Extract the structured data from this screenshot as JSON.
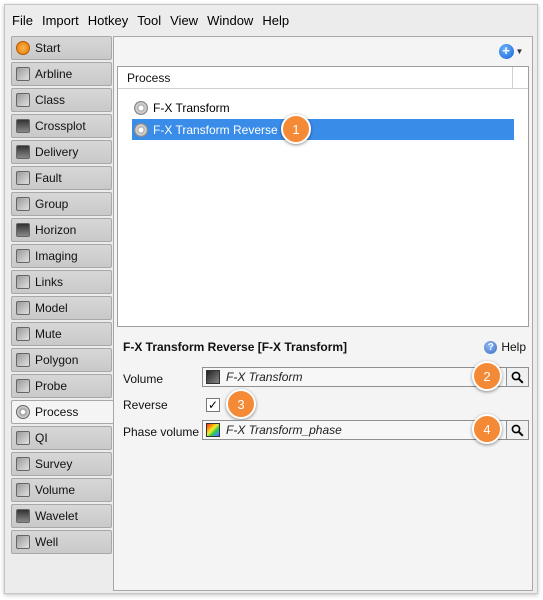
{
  "menu": [
    "File",
    "Import",
    "Hotkey",
    "Tool",
    "View",
    "Window",
    "Help"
  ],
  "sidebar": {
    "items": [
      {
        "label": "Start",
        "icon": "start-icon"
      },
      {
        "label": "Arbline",
        "icon": "arbline-icon"
      },
      {
        "label": "Class",
        "icon": "class-icon"
      },
      {
        "label": "Crossplot",
        "icon": "crossplot-icon"
      },
      {
        "label": "Delivery",
        "icon": "delivery-icon"
      },
      {
        "label": "Fault",
        "icon": "fault-icon"
      },
      {
        "label": "Group",
        "icon": "group-icon"
      },
      {
        "label": "Horizon",
        "icon": "horizon-icon"
      },
      {
        "label": "Imaging",
        "icon": "imaging-icon"
      },
      {
        "label": "Links",
        "icon": "links-icon"
      },
      {
        "label": "Model",
        "icon": "model-icon"
      },
      {
        "label": "Mute",
        "icon": "mute-icon"
      },
      {
        "label": "Polygon",
        "icon": "polygon-icon"
      },
      {
        "label": "Probe",
        "icon": "probe-icon"
      },
      {
        "label": "Process",
        "icon": "process-icon"
      },
      {
        "label": "QI",
        "icon": "qi-icon"
      },
      {
        "label": "Survey",
        "icon": "survey-icon"
      },
      {
        "label": "Volume",
        "icon": "volume-icon"
      },
      {
        "label": "Wavelet",
        "icon": "wavelet-icon"
      },
      {
        "label": "Well",
        "icon": "well-icon"
      }
    ],
    "active": "Process"
  },
  "process_list": {
    "header": "Process",
    "rows": [
      {
        "label": "F-X Transform",
        "selected": false
      },
      {
        "label": "F-X Transform Reverse",
        "selected": true
      }
    ]
  },
  "properties": {
    "title": "F-X Transform Reverse [F-X Transform]",
    "help_label": "Help",
    "volume_label": "Volume",
    "volume_value": "F-X Transform",
    "reverse_label": "Reverse",
    "reverse_checked": true,
    "reverse_check_glyph": "✓",
    "phase_label": "Phase volume",
    "phase_value": "F-X Transform_phase"
  },
  "callouts": [
    "1",
    "2",
    "3",
    "4"
  ],
  "toolbar": {
    "add_glyph": "+",
    "menu_caret": "▼"
  },
  "colors": {
    "selection": "#3a8ce9",
    "callout": "#f48a36",
    "accent": "#1360d6"
  }
}
